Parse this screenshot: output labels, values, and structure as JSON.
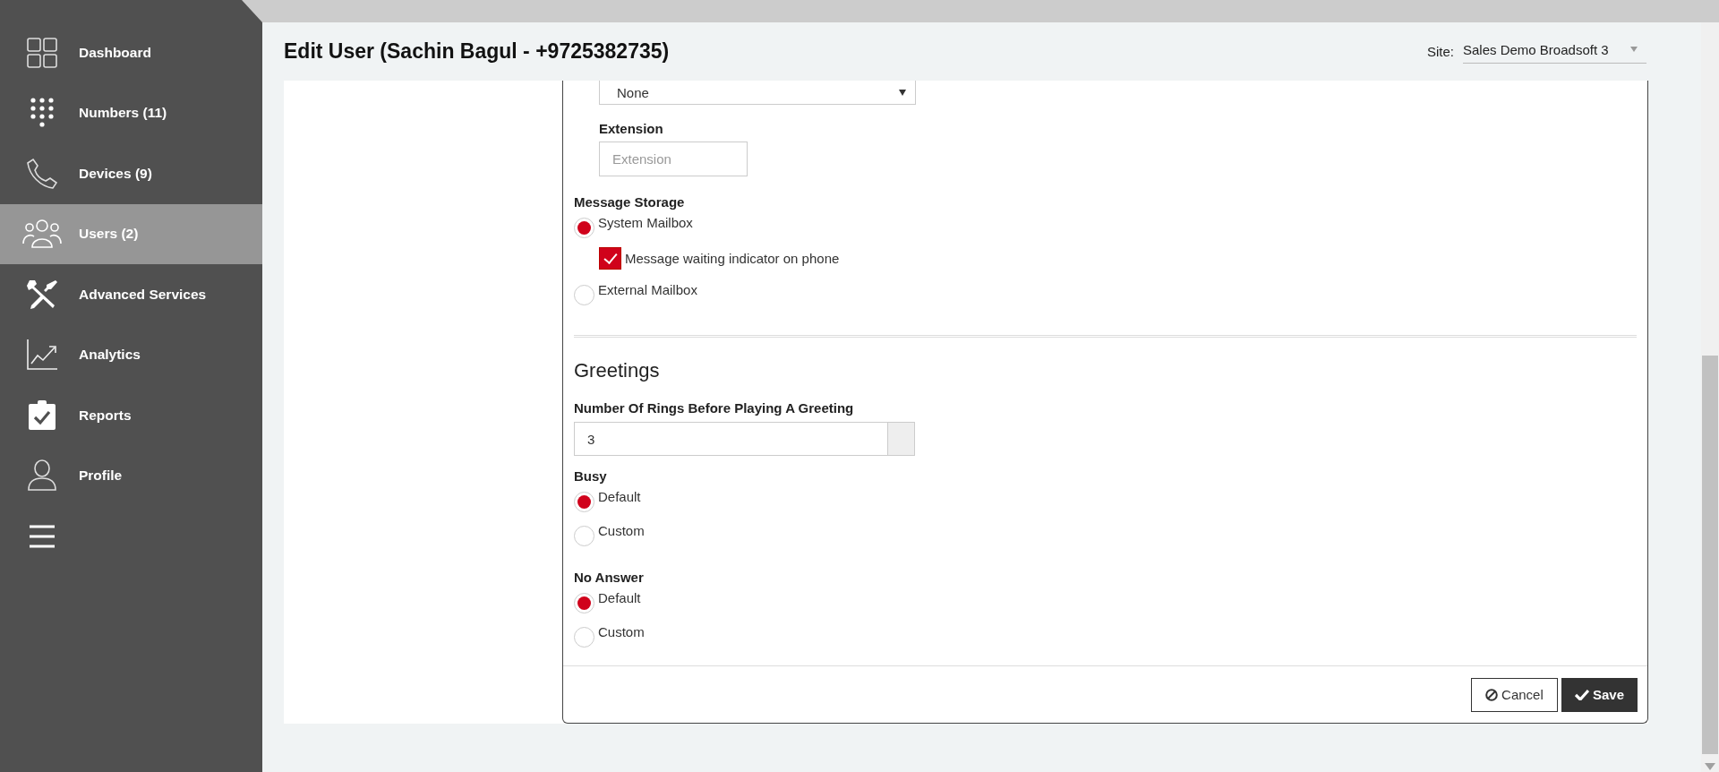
{
  "sidebar": {
    "items": [
      {
        "label": "Dashboard",
        "selected": false
      },
      {
        "label": "Numbers (11)",
        "selected": false
      },
      {
        "label": "Devices (9)",
        "selected": false
      },
      {
        "label": "Users (2)",
        "selected": true
      },
      {
        "label": "Advanced Services",
        "selected": false
      },
      {
        "label": "Analytics",
        "selected": false
      },
      {
        "label": "Reports",
        "selected": false
      },
      {
        "label": "Profile",
        "selected": false
      }
    ]
  },
  "header": {
    "title": "Edit User (Sachin Bagul - +9725382735)",
    "site_label": "Site:",
    "site_value": "Sales Demo Broadsoft 3"
  },
  "form": {
    "dropdown": {
      "value": "None"
    },
    "extension": {
      "label": "Extension",
      "placeholder": "Extension"
    },
    "message_storage": {
      "label": "Message Storage",
      "options": [
        {
          "label": "System Mailbox",
          "selected": true
        },
        {
          "label": "External Mailbox",
          "selected": false
        }
      ],
      "indicator": {
        "label": "Message waiting indicator on phone",
        "checked": true
      }
    },
    "greetings": {
      "title": "Greetings",
      "rings": {
        "label": "Number Of Rings Before Playing A Greeting",
        "value": "3"
      },
      "groups": [
        {
          "label": "Busy",
          "options": [
            {
              "label": "Default",
              "selected": true
            },
            {
              "label": "Custom",
              "selected": false
            }
          ]
        },
        {
          "label": "No Answer",
          "options": [
            {
              "label": "Default",
              "selected": true
            },
            {
              "label": "Custom",
              "selected": false
            }
          ]
        }
      ]
    },
    "buttons": [
      {
        "label": "Cancel",
        "kind": "cancel"
      },
      {
        "label": "Save",
        "kind": "save"
      }
    ]
  }
}
